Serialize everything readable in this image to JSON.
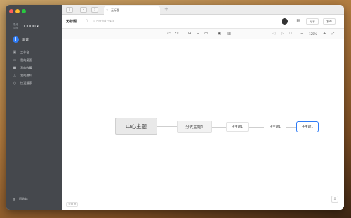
{
  "window": {
    "tab_title": "无标题"
  },
  "sidebar": {
    "account_logo": "思维导图",
    "account_name": "OOOOO ▾",
    "new_label": "新建",
    "items": [
      {
        "icon": "home-icon",
        "label": "工作台"
      },
      {
        "icon": "folder-icon",
        "label": "我的桌面"
      },
      {
        "icon": "star-icon",
        "label": "我的收藏"
      },
      {
        "icon": "bell-icon",
        "label": "我的通知"
      },
      {
        "icon": "search-icon",
        "label": "快速搜索"
      }
    ],
    "trash_label": "回收站"
  },
  "doc": {
    "title": "无标题",
    "status": "◎ 所有修改已保存",
    "buttons": [
      "分享",
      "发布"
    ]
  },
  "toolbar": {
    "zoom": "125%"
  },
  "mindmap": {
    "central": "中心主题",
    "branch": "分支主题1",
    "subs": [
      "子主题1",
      "子主题1",
      "子主题1"
    ]
  },
  "footer": {
    "chip": "大纲 ≡"
  }
}
